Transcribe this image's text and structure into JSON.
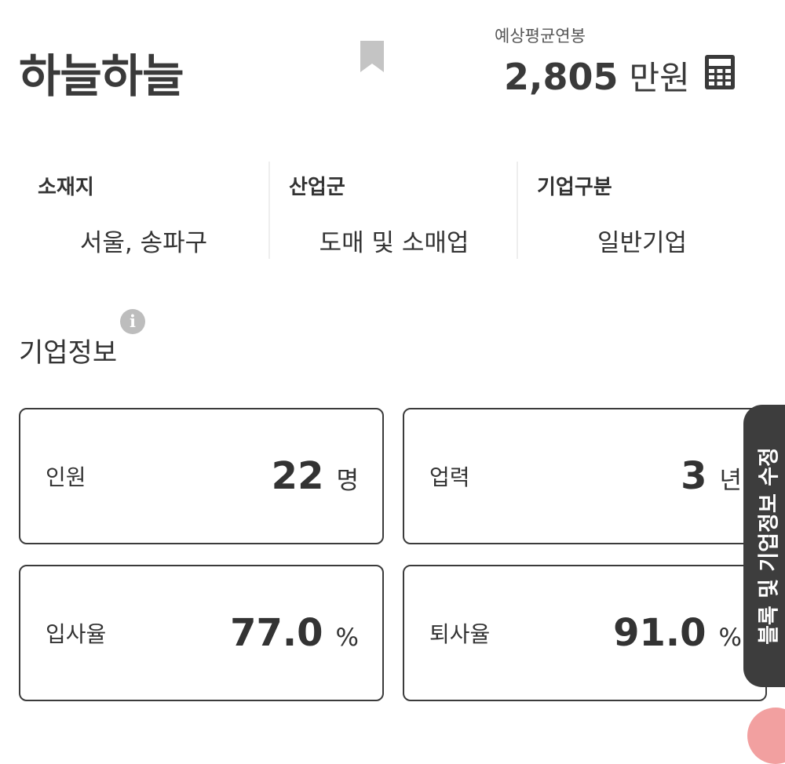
{
  "company": {
    "name": "하늘하늘"
  },
  "salary": {
    "label": "예상평균연봉",
    "value": "2,805",
    "unit": "만원"
  },
  "info": [
    {
      "label": "소재지",
      "value": "서울, 송파구"
    },
    {
      "label": "산업군",
      "value": "도매 및 소매업"
    },
    {
      "label": "기업구분",
      "value": "일반기업"
    }
  ],
  "section": {
    "title": "기업정보",
    "info_icon_glyph": "i"
  },
  "stats": [
    {
      "label": "인원",
      "value": "22",
      "unit": "명"
    },
    {
      "label": "업력",
      "value": "3",
      "unit": "년"
    },
    {
      "label": "입사율",
      "value": "77.0",
      "unit": "%"
    },
    {
      "label": "퇴사율",
      "value": "91.0",
      "unit": "%"
    }
  ],
  "side_tab": {
    "label": "블록 및 기업정보 수정"
  },
  "icons": {
    "bookmark": "bookmark-icon",
    "calculator": "calculator-icon",
    "info": "info-icon"
  },
  "colors": {
    "text": "#333333",
    "card_border": "#3b3b3b",
    "side_tab_bg": "#3d3d3d",
    "icon_gray": "#bdbdbd",
    "accent_pink": "#f2a0a0"
  }
}
